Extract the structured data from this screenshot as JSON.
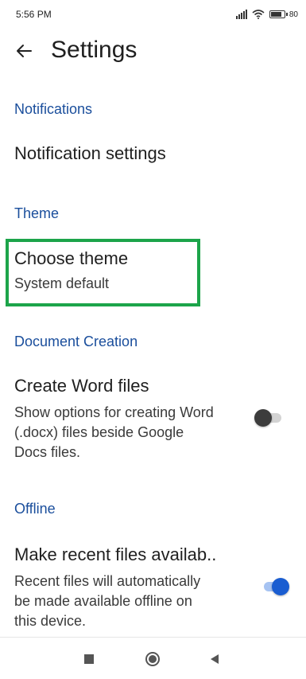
{
  "status_bar": {
    "time": "5:56 PM",
    "battery_percent": "80",
    "battery_level": 0.8,
    "icons": [
      "signal-icon",
      "wifi-icon",
      "battery-icon"
    ]
  },
  "header": {
    "back_icon": "arrow-left-icon",
    "title": "Settings"
  },
  "sections": {
    "notifications": {
      "header": "Notifications",
      "row_title": "Notification settings"
    },
    "theme": {
      "header": "Theme",
      "row_title": "Choose theme",
      "row_value": "System default",
      "highlight_color": "#1ca44a"
    },
    "document_creation": {
      "header": "Document Creation",
      "row_title": "Create Word files",
      "desc_lines": [
        "Show options for creating Word",
        "(.docx) files beside Google",
        "Docs files."
      ],
      "toggle_on": false
    },
    "offline": {
      "header": "Offline",
      "row_title": "Make recent files availab..",
      "desc_lines": [
        "Recent files will automatically",
        "be made available offline on",
        "this device."
      ],
      "toggle_on": true
    }
  },
  "nav_bar": {
    "buttons": [
      "square-icon",
      "home-circle-icon",
      "back-triangle-icon"
    ]
  },
  "colors": {
    "section_header": "#1a4e9c",
    "toggle_on": "#1a5dd1",
    "toggle_off_thumb": "#3c3c3c"
  }
}
